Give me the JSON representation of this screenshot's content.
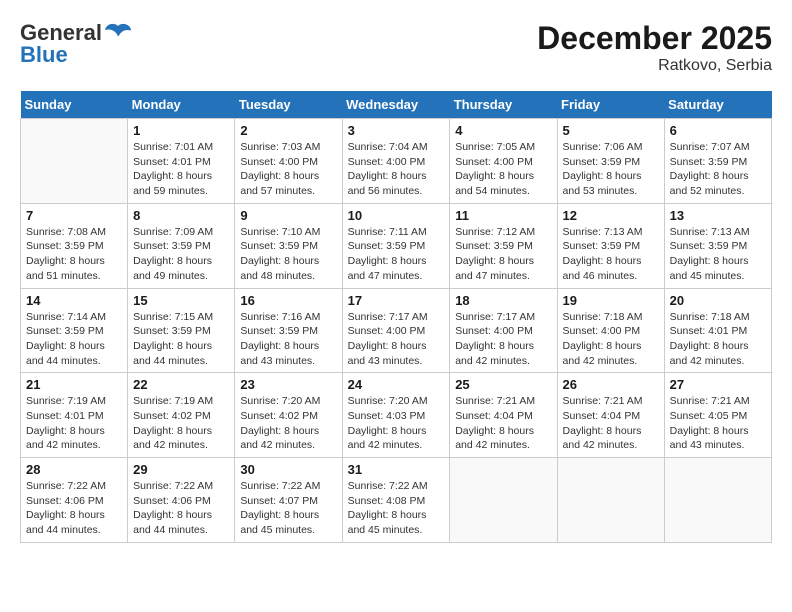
{
  "logo": {
    "line1": "General",
    "line2": "Blue"
  },
  "title": "December 2025",
  "subtitle": "Ratkovo, Serbia",
  "days_of_week": [
    "Sunday",
    "Monday",
    "Tuesday",
    "Wednesday",
    "Thursday",
    "Friday",
    "Saturday"
  ],
  "weeks": [
    [
      {
        "day": "",
        "detail": ""
      },
      {
        "day": "1",
        "detail": "Sunrise: 7:01 AM\nSunset: 4:01 PM\nDaylight: 8 hours\nand 59 minutes."
      },
      {
        "day": "2",
        "detail": "Sunrise: 7:03 AM\nSunset: 4:00 PM\nDaylight: 8 hours\nand 57 minutes."
      },
      {
        "day": "3",
        "detail": "Sunrise: 7:04 AM\nSunset: 4:00 PM\nDaylight: 8 hours\nand 56 minutes."
      },
      {
        "day": "4",
        "detail": "Sunrise: 7:05 AM\nSunset: 4:00 PM\nDaylight: 8 hours\nand 54 minutes."
      },
      {
        "day": "5",
        "detail": "Sunrise: 7:06 AM\nSunset: 3:59 PM\nDaylight: 8 hours\nand 53 minutes."
      },
      {
        "day": "6",
        "detail": "Sunrise: 7:07 AM\nSunset: 3:59 PM\nDaylight: 8 hours\nand 52 minutes."
      }
    ],
    [
      {
        "day": "7",
        "detail": "Sunrise: 7:08 AM\nSunset: 3:59 PM\nDaylight: 8 hours\nand 51 minutes."
      },
      {
        "day": "8",
        "detail": "Sunrise: 7:09 AM\nSunset: 3:59 PM\nDaylight: 8 hours\nand 49 minutes."
      },
      {
        "day": "9",
        "detail": "Sunrise: 7:10 AM\nSunset: 3:59 PM\nDaylight: 8 hours\nand 48 minutes."
      },
      {
        "day": "10",
        "detail": "Sunrise: 7:11 AM\nSunset: 3:59 PM\nDaylight: 8 hours\nand 47 minutes."
      },
      {
        "day": "11",
        "detail": "Sunrise: 7:12 AM\nSunset: 3:59 PM\nDaylight: 8 hours\nand 47 minutes."
      },
      {
        "day": "12",
        "detail": "Sunrise: 7:13 AM\nSunset: 3:59 PM\nDaylight: 8 hours\nand 46 minutes."
      },
      {
        "day": "13",
        "detail": "Sunrise: 7:13 AM\nSunset: 3:59 PM\nDaylight: 8 hours\nand 45 minutes."
      }
    ],
    [
      {
        "day": "14",
        "detail": "Sunrise: 7:14 AM\nSunset: 3:59 PM\nDaylight: 8 hours\nand 44 minutes."
      },
      {
        "day": "15",
        "detail": "Sunrise: 7:15 AM\nSunset: 3:59 PM\nDaylight: 8 hours\nand 44 minutes."
      },
      {
        "day": "16",
        "detail": "Sunrise: 7:16 AM\nSunset: 3:59 PM\nDaylight: 8 hours\nand 43 minutes."
      },
      {
        "day": "17",
        "detail": "Sunrise: 7:17 AM\nSunset: 4:00 PM\nDaylight: 8 hours\nand 43 minutes."
      },
      {
        "day": "18",
        "detail": "Sunrise: 7:17 AM\nSunset: 4:00 PM\nDaylight: 8 hours\nand 42 minutes."
      },
      {
        "day": "19",
        "detail": "Sunrise: 7:18 AM\nSunset: 4:00 PM\nDaylight: 8 hours\nand 42 minutes."
      },
      {
        "day": "20",
        "detail": "Sunrise: 7:18 AM\nSunset: 4:01 PM\nDaylight: 8 hours\nand 42 minutes."
      }
    ],
    [
      {
        "day": "21",
        "detail": "Sunrise: 7:19 AM\nSunset: 4:01 PM\nDaylight: 8 hours\nand 42 minutes."
      },
      {
        "day": "22",
        "detail": "Sunrise: 7:19 AM\nSunset: 4:02 PM\nDaylight: 8 hours\nand 42 minutes."
      },
      {
        "day": "23",
        "detail": "Sunrise: 7:20 AM\nSunset: 4:02 PM\nDaylight: 8 hours\nand 42 minutes."
      },
      {
        "day": "24",
        "detail": "Sunrise: 7:20 AM\nSunset: 4:03 PM\nDaylight: 8 hours\nand 42 minutes."
      },
      {
        "day": "25",
        "detail": "Sunrise: 7:21 AM\nSunset: 4:04 PM\nDaylight: 8 hours\nand 42 minutes."
      },
      {
        "day": "26",
        "detail": "Sunrise: 7:21 AM\nSunset: 4:04 PM\nDaylight: 8 hours\nand 42 minutes."
      },
      {
        "day": "27",
        "detail": "Sunrise: 7:21 AM\nSunset: 4:05 PM\nDaylight: 8 hours\nand 43 minutes."
      }
    ],
    [
      {
        "day": "28",
        "detail": "Sunrise: 7:22 AM\nSunset: 4:06 PM\nDaylight: 8 hours\nand 44 minutes."
      },
      {
        "day": "29",
        "detail": "Sunrise: 7:22 AM\nSunset: 4:06 PM\nDaylight: 8 hours\nand 44 minutes."
      },
      {
        "day": "30",
        "detail": "Sunrise: 7:22 AM\nSunset: 4:07 PM\nDaylight: 8 hours\nand 45 minutes."
      },
      {
        "day": "31",
        "detail": "Sunrise: 7:22 AM\nSunset: 4:08 PM\nDaylight: 8 hours\nand 45 minutes."
      },
      {
        "day": "",
        "detail": ""
      },
      {
        "day": "",
        "detail": ""
      },
      {
        "day": "",
        "detail": ""
      }
    ]
  ]
}
